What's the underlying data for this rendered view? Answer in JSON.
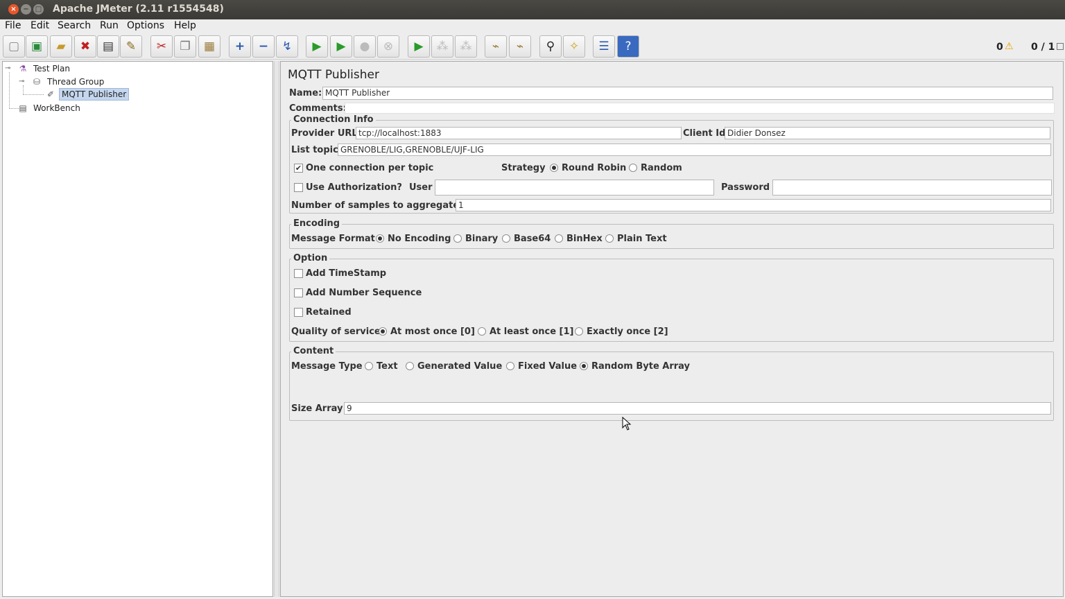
{
  "window": {
    "title": "Apache JMeter (2.11 r1554548)"
  },
  "menu": [
    "File",
    "Edit",
    "Search",
    "Run",
    "Options",
    "Help"
  ],
  "toolbar": {
    "icons": [
      "new-icon",
      "templates-icon",
      "open-icon",
      "close-icon",
      "save-icon",
      "save-as-icon",
      "cut-icon",
      "copy-icon",
      "paste-icon",
      "expand-icon",
      "collapse-icon",
      "toggle-icon",
      "start-icon",
      "start-no-timers-icon",
      "stop-icon",
      "shutdown-icon",
      "remote-start-icon",
      "remote-stop-icon",
      "remote-exit-icon",
      "clear-icon",
      "clear-all-icon",
      "search-icon",
      "reset-search-icon",
      "function-helper-icon",
      "help-icon"
    ],
    "errors_count": "0",
    "threads": "0 / 1"
  },
  "tree": {
    "items": [
      "Test Plan",
      "Thread Group",
      "MQTT Publisher",
      "WorkBench"
    ]
  },
  "panel": {
    "title": "MQTT Publisher",
    "name_label": "Name:",
    "name_value": "MQTT Publisher",
    "comments_label": "Comments:",
    "comments_value": "",
    "connection": {
      "legend": "Connection Info",
      "provider_label": "Provider URL",
      "provider_value": "tcp://localhost:1883",
      "client_label": "Client Id",
      "client_value": "Didier Donsez",
      "topic_label": "List topic",
      "topic_value": "GRENOBLE/LIG,GRENOBLE/UJF-LIG",
      "one_conn_label": "One connection per topic",
      "one_conn_checked": true,
      "strategy_label": "Strategy",
      "strategy_options": [
        "Round Robin",
        "Random"
      ],
      "strategy_selected": "Round Robin",
      "auth_label": "Use Authorization?",
      "auth_checked": false,
      "user_label": "User",
      "user_value": "",
      "password_label": "Password",
      "password_value": "",
      "samples_label": "Number of samples to aggregate",
      "samples_value": "1"
    },
    "encoding": {
      "legend": "Encoding",
      "format_label": "Message Format",
      "options": [
        "No Encoding",
        "Binary",
        "Base64",
        "BinHex",
        "Plain Text"
      ],
      "selected": "No Encoding"
    },
    "option": {
      "legend": "Option",
      "timestamp_label": "Add TimeStamp",
      "sequence_label": "Add Number Sequence",
      "retained_label": "Retained",
      "qos_label": "Quality of service",
      "qos_options": [
        "At most once [0]",
        "At least once [1]",
        "Exactly once [2]"
      ],
      "qos_selected": "At most once [0]"
    },
    "content": {
      "legend": "Content",
      "type_label": "Message Type",
      "type_options": [
        "Text",
        "Generated Value",
        "Fixed Value",
        "Random Byte Array"
      ],
      "type_selected": "Random Byte Array",
      "size_label": "Size Array",
      "size_value": "9"
    }
  }
}
